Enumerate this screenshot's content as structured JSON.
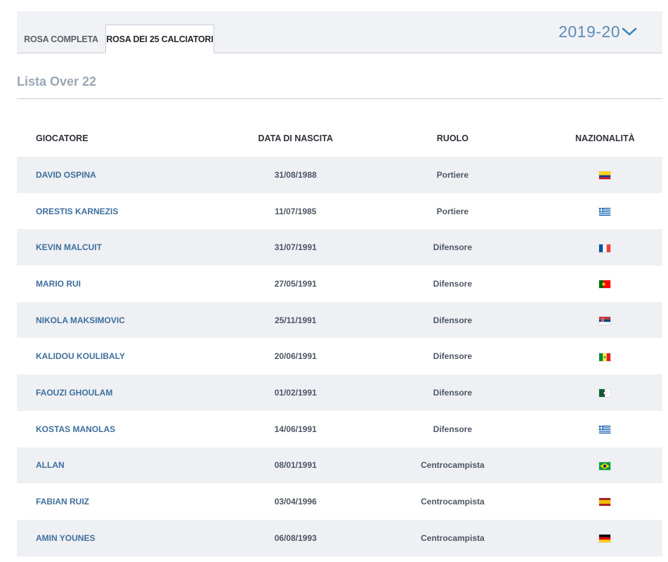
{
  "tabs": [
    "ROSA COMPLETA",
    "ROSA DEI 25 CALCIATORI"
  ],
  "season": "2019-20",
  "section_title": "Lista Over 22",
  "columns": [
    "GIOCATORE",
    "DATA DI NASCITA",
    "RUOLO",
    "NAZIONALITÀ"
  ],
  "players": [
    {
      "name": "DAVID OSPINA",
      "birth": "31/08/1988",
      "role": "Portiere",
      "flag": "colombia-flag-icon"
    },
    {
      "name": "ORESTIS KARNEZIS",
      "birth": "11/07/1985",
      "role": "Portiere",
      "flag": "greece-flag-icon"
    },
    {
      "name": "KEVIN MALCUIT",
      "birth": "31/07/1991",
      "role": "Difensore",
      "flag": "france-flag-icon"
    },
    {
      "name": "MARIO RUI",
      "birth": "27/05/1991",
      "role": "Difensore",
      "flag": "portugal-flag-icon"
    },
    {
      "name": "NIKOLA MAKSIMOVIC",
      "birth": "25/11/1991",
      "role": "Difensore",
      "flag": "serbia-flag-icon"
    },
    {
      "name": "KALIDOU KOULIBALY",
      "birth": "20/06/1991",
      "role": "Difensore",
      "flag": "senegal-flag-icon"
    },
    {
      "name": "FAOUZI GHOULAM",
      "birth": "01/02/1991",
      "role": "Difensore",
      "flag": "algeria-flag-icon"
    },
    {
      "name": "KOSTAS MANOLAS",
      "birth": "14/06/1991",
      "role": "Difensore",
      "flag": "greece-flag-icon"
    },
    {
      "name": "ALLAN",
      "birth": "08/01/1991",
      "role": "Centrocampista",
      "flag": "brazil-flag-icon"
    },
    {
      "name": "FABIAN RUIZ",
      "birth": "03/04/1996",
      "role": "Centrocampista",
      "flag": "spain-flag-icon"
    },
    {
      "name": "AMIN YOUNES",
      "birth": "06/08/1993",
      "role": "Centrocampista",
      "flag": "germany-flag-icon"
    }
  ]
}
